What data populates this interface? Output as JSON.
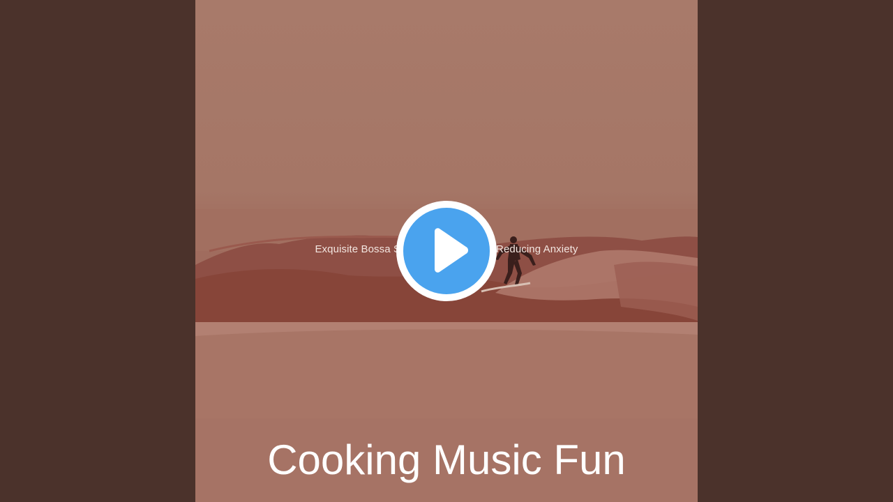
{
  "video": {
    "track_title": "Exquisite Bossa Saxophone Music for Reducing Anxiety",
    "artist": "Cooking Music Fun"
  },
  "colors": {
    "sidebar_background": "#4b322b",
    "artwork_tint": "#a57666",
    "play_button_fill": "#4aa3ee",
    "play_button_ring": "#ffffff"
  },
  "icons": {
    "play": "play-icon"
  }
}
